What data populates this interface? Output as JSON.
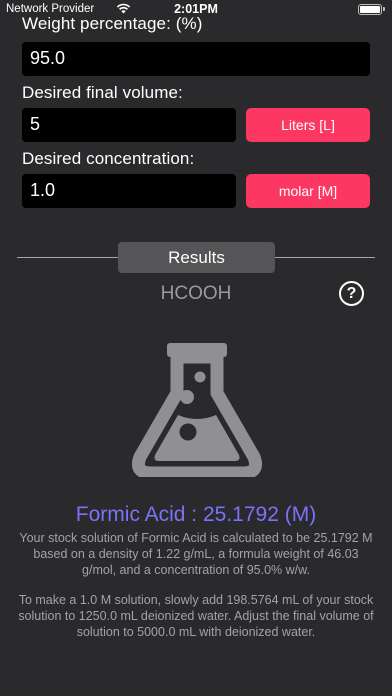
{
  "status_bar": {
    "carrier": "Network Provider",
    "time": "2:01PM",
    "battery_level": 1.0
  },
  "form": {
    "weight_percentage_label": "Weight percentage:  (%)",
    "weight_percentage_value": "95.0",
    "final_volume_label": "Desired final volume:",
    "final_volume_value": "5",
    "volume_unit_button": "Liters [L]",
    "concentration_label": "Desired concentration:",
    "concentration_value": "1.0",
    "concentration_unit_button": "molar [M]"
  },
  "results": {
    "tab_label": "Results",
    "formula": "HCOOH",
    "help_glyph": "?",
    "title": "Formic Acid : 25.1792 (M)",
    "description_1": "Your stock solution of Formic Acid is calculated to be 25.1792 M based on a density of 1.22 g/mL, a formula weight of 46.03 g/mol, and a concentration of 95.0% w/w.",
    "description_2": "To make a 1.0 M solution, slowly add 198.5764 mL of your stock solution to 1250.0 mL deionized water. Adjust the final volume of solution to 5000.0 mL with deionized water."
  },
  "colors": {
    "background": "#2a2a2c",
    "accent_button": "#fc3862",
    "result_title": "#7b72f8",
    "muted_text": "#a3a3a5"
  },
  "icons": {
    "wifi": "wifi-icon",
    "battery": "battery-icon",
    "help": "help-icon",
    "flask": "flask-icon"
  }
}
